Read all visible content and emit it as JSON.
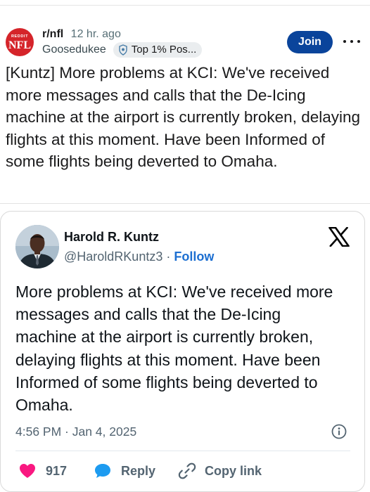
{
  "post": {
    "subreddit": "r/nfl",
    "time_ago": "12 hr. ago",
    "username": "Goosedukee",
    "flair": "Top 1% Pos...",
    "join_label": "Join",
    "title": "[Kuntz] More problems at KCI: We've received more messages and calls that the De-Icing machine at the airport is currently broken, delaying flights at this moment. Have been Informed of some flights being deverted to Omaha.",
    "logo_text": {
      "top": "REDDIT",
      "main": "NFL"
    }
  },
  "tweet": {
    "author_name": "Harold R. Kuntz",
    "handle": "@HaroldRKuntz3",
    "separator": "·",
    "follow_label": "Follow",
    "text": "More problems at KCI: We've received more messages and calls that the De-Icing machine at the airport is currently broken, delaying flights at this moment. Have been Informed of some flights being deverted to Omaha.",
    "timestamp": "4:56 PM · Jan 4, 2025",
    "likes": "917",
    "reply_label": "Reply",
    "copy_link_label": "Copy link"
  },
  "colors": {
    "join_button": "#0a449b",
    "nfl_logo": "#d5242a",
    "like_heart": "#f91880",
    "reply_bubble": "#1d9bf0",
    "follow_link": "#1d6fd1"
  },
  "icons": [
    "nfl-logo",
    "flair-badge-icon",
    "more-options-icon",
    "x-logo",
    "info-icon",
    "heart-icon",
    "reply-icon",
    "link-icon"
  ]
}
